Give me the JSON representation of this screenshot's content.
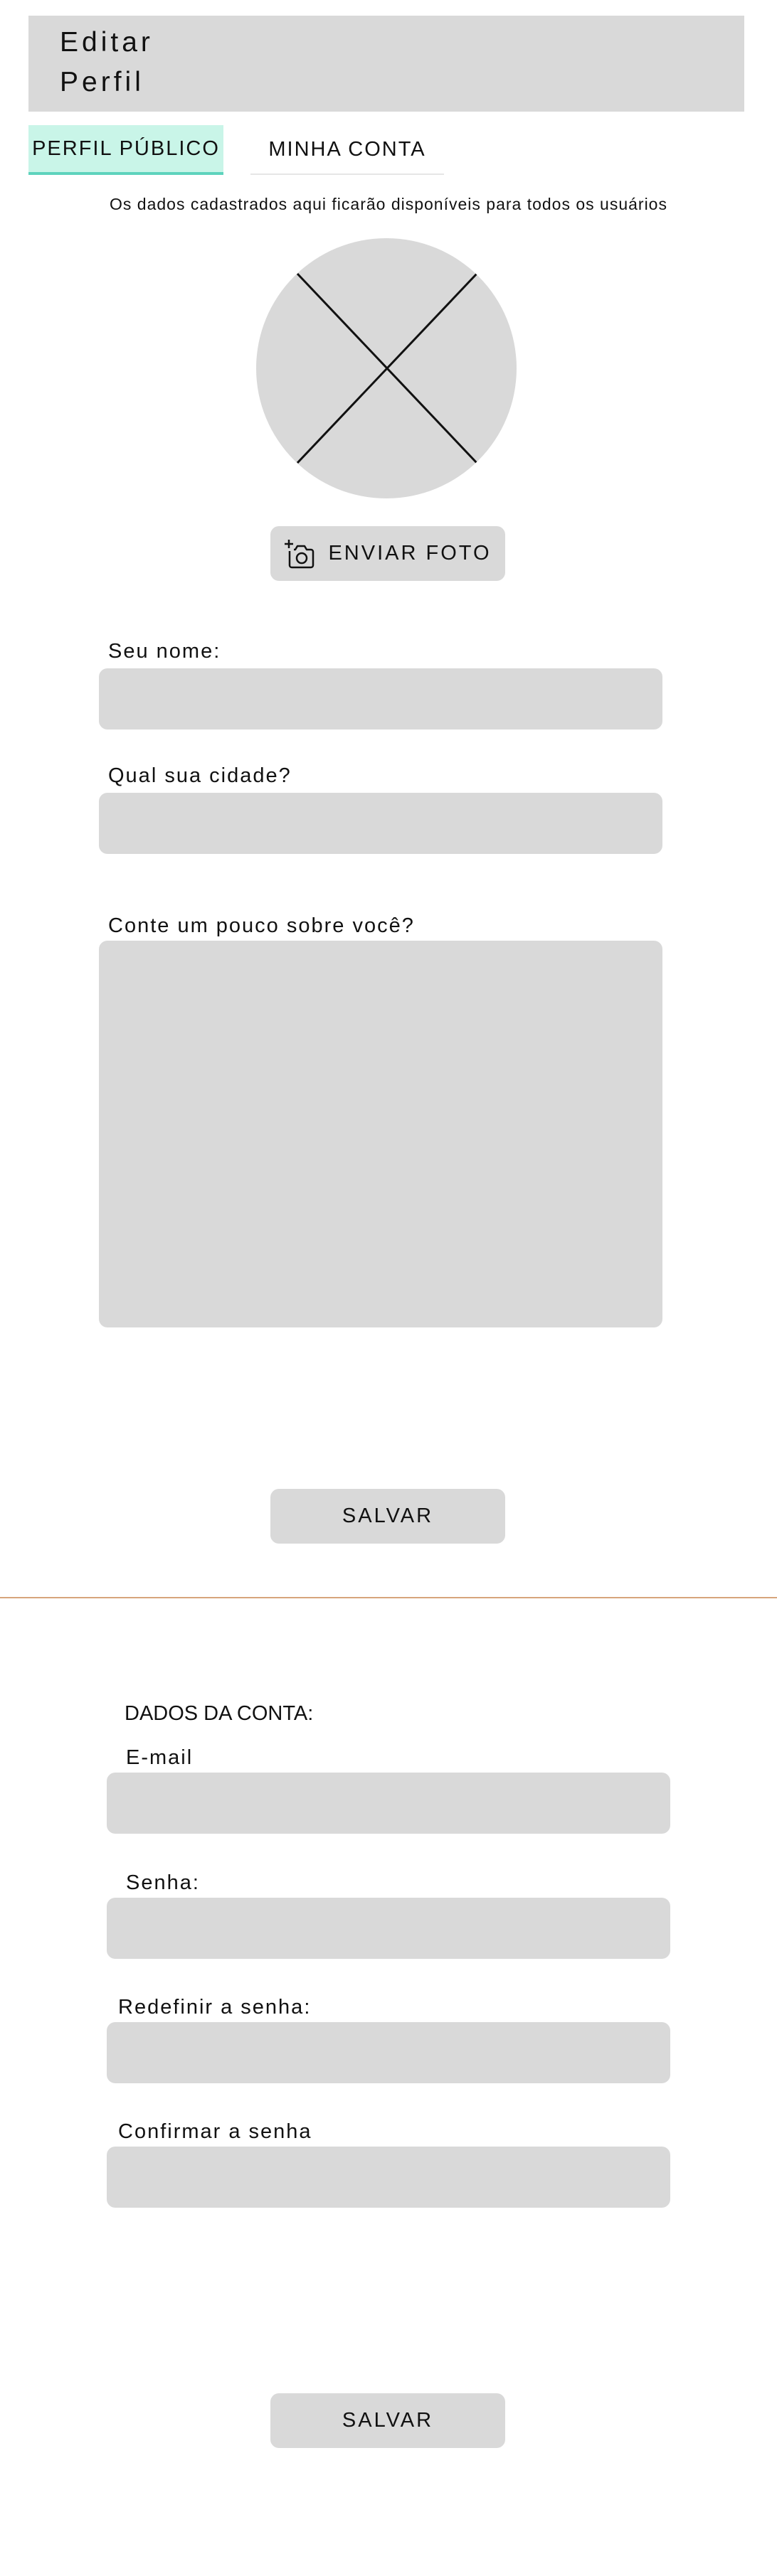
{
  "header": {
    "title": "Editar\nPerfil"
  },
  "tabs": [
    {
      "label": "PERFIL PÚBLICO",
      "active": true
    },
    {
      "label": "MINHA CONTA",
      "active": false
    }
  ],
  "notice": "Os dados cadastrados aqui ficarão disponíveis para todos os usuários",
  "avatar": {
    "icon": "placeholder-x-icon"
  },
  "photo_button": {
    "label": "ENVIAR FOTO",
    "icon": "camera-add-icon"
  },
  "public_form": {
    "name_label": "Seu nome:",
    "city_label": "Qual sua cidade?",
    "about_label": "Conte um pouco sobre você?",
    "save_label": "SALVAR"
  },
  "account_form": {
    "section_title": "DADOS DA CONTA:",
    "email_label": "E-mail",
    "password_label": "Senha:",
    "reset_label": "Redefinir a senha:",
    "confirm_label": "Confirmar a senha",
    "save_label": "SALVAR"
  },
  "colors": {
    "field_bg": "#d9d9d9",
    "tab_active_bg": "#c9f5e8",
    "tab_active_border": "#5ed3bd",
    "divider": "#d7a57c"
  }
}
